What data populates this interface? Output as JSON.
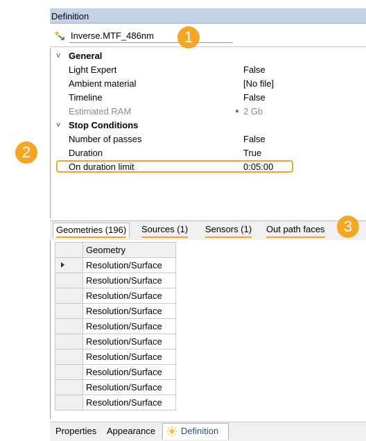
{
  "panel": {
    "title": "Definition"
  },
  "feature": {
    "name": "Inverse.MTF_486nm",
    "icon": "sparkle-arrow-icon"
  },
  "properties": {
    "general": {
      "label": "General",
      "items": [
        {
          "label": "Light Expert",
          "value": "False"
        },
        {
          "label": "Ambient material",
          "value": "[No file]"
        },
        {
          "label": "Timeline",
          "value": "False"
        },
        {
          "label": "Estimated RAM",
          "value": "2 Gb"
        }
      ]
    },
    "stop_conditions": {
      "label": "Stop Conditions",
      "items": [
        {
          "label": "Number of passes",
          "value": "False"
        },
        {
          "label": "Duration",
          "value": "True"
        },
        {
          "label": "On duration limit",
          "value": "0:05:00"
        }
      ]
    }
  },
  "tabs": [
    {
      "label": "Geometries (196)"
    },
    {
      "label": "Sources (1)"
    },
    {
      "label": "Sensors (1)"
    },
    {
      "label": "Out path faces"
    }
  ],
  "table": {
    "header": "Geometry",
    "rows": [
      "Resolution/Surface",
      "Resolution/Surface",
      "Resolution/Surface",
      "Resolution/Surface",
      "Resolution/Surface",
      "Resolution/Surface",
      "Resolution/Surface",
      "Resolution/Surface",
      "Resolution/Surface",
      "Resolution/Surface"
    ]
  },
  "bottom_tabs": [
    {
      "label": "Properties"
    },
    {
      "label": "Appearance"
    },
    {
      "label": "Definition"
    }
  ],
  "callouts": [
    "1",
    "2",
    "3"
  ],
  "colors": {
    "accent": "#f5a623",
    "header_bg": "#c5d3e8",
    "info": "#3a7bd5",
    "active_tab_text": "#1f4e9a"
  }
}
